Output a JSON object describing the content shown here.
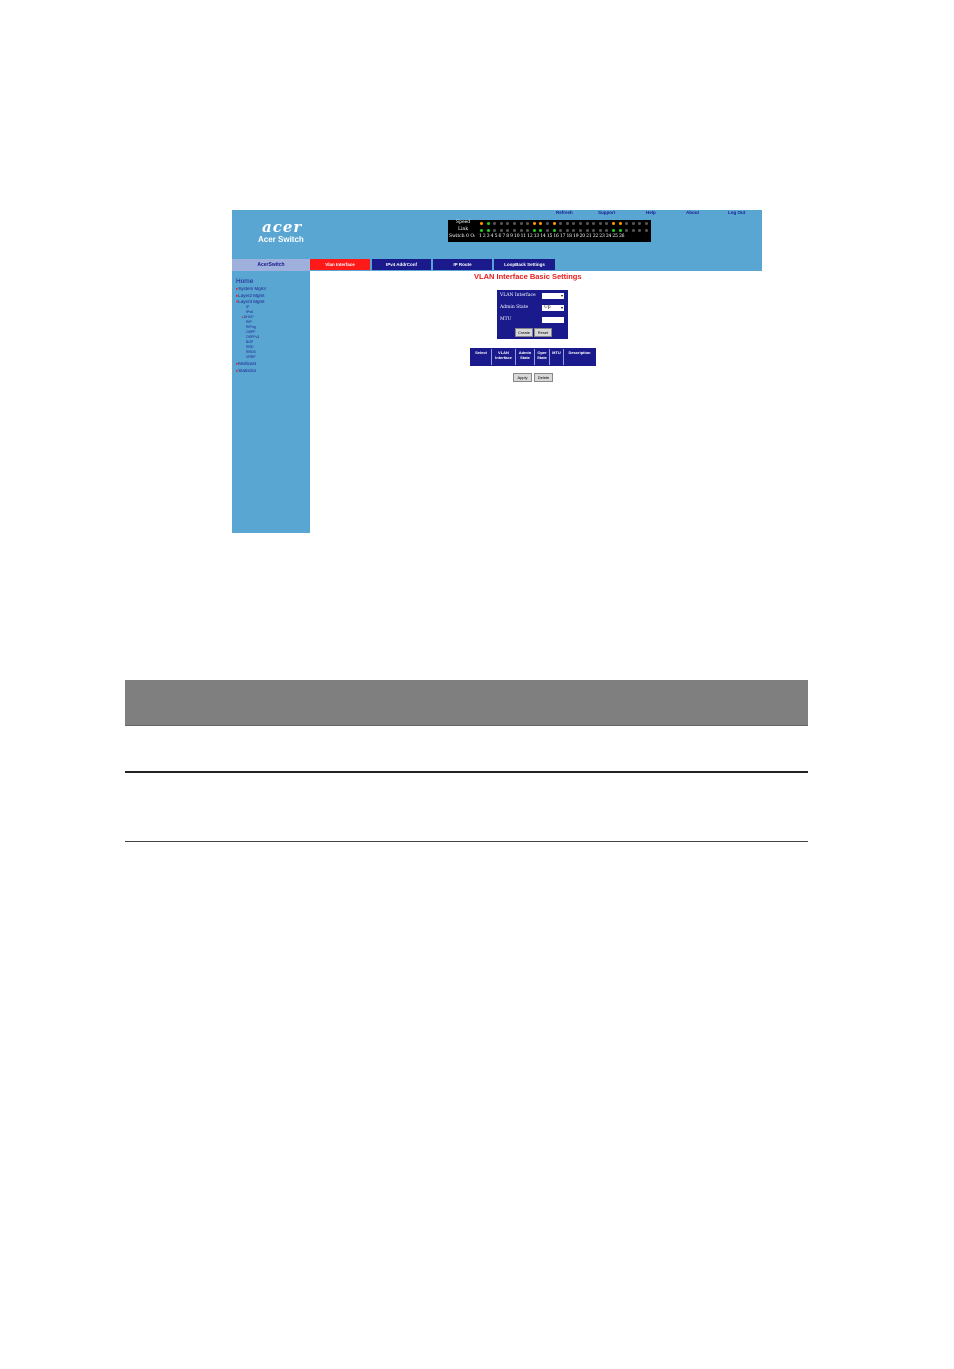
{
  "header": {
    "logo_text": "acer",
    "product_name": "Acer Switch",
    "top_links": [
      "Refresh",
      "Support",
      "Help",
      "About",
      "Log Out"
    ]
  },
  "port_panel": {
    "row_labels": [
      "Speed",
      "Link",
      "Switch 0 O:"
    ],
    "port_numbers": "1 2 3 4 5 6 7 8 9 10 11 12 13 14 15 16 17 18 19 20 21 22 23 24 25 26",
    "colors": {
      "green": "#22cc22",
      "orange": "#ff9900",
      "off": "#555555"
    }
  },
  "sidebar": {
    "title": "AcerSwitch",
    "items": [
      {
        "label": "Home"
      },
      {
        "label": "System Mgmt"
      },
      {
        "label": "Layer2 Mgmt"
      },
      {
        "label": "Layer3 Mgmt"
      },
      {
        "label": "IP"
      },
      {
        "label": "IPv6"
      },
      {
        "label": "DHCP"
      },
      {
        "label": "RIP"
      },
      {
        "label": "RIPng"
      },
      {
        "label": "OSPF"
      },
      {
        "label": "OSPFv3"
      },
      {
        "label": "BGP"
      },
      {
        "label": "RRD"
      },
      {
        "label": "RRD6"
      },
      {
        "label": "VRRP"
      },
      {
        "label": "Multicast"
      },
      {
        "label": "Statistics"
      }
    ]
  },
  "tabs": [
    {
      "label": "Vlan Interface",
      "active": true
    },
    {
      "label": "IPv4 AddrConf",
      "active": false
    },
    {
      "label": "IP Route",
      "active": false
    },
    {
      "label": "LoopBack Settings",
      "active": false
    }
  ],
  "content": {
    "title": "VLAN Interface Basic Settings",
    "form": {
      "vlan_interface_label": "VLAN Interface",
      "vlan_interface_value": "",
      "admin_state_label": "Admin State",
      "admin_state_value": "Up",
      "mtu_label": "MTU",
      "mtu_value": "",
      "create_button": "Create",
      "reset_button": "Reset"
    },
    "table_headers": [
      {
        "line1": "Select",
        "line2": ""
      },
      {
        "line1": "VLAN",
        "line2": "Interface"
      },
      {
        "line1": "Admin",
        "line2": "State"
      },
      {
        "line1": "Oper",
        "line2": "State"
      },
      {
        "line1": "MTU",
        "line2": ""
      },
      {
        "line1": "Description",
        "line2": ""
      }
    ],
    "apply_button": "Apply",
    "delete_button": "Delete"
  }
}
